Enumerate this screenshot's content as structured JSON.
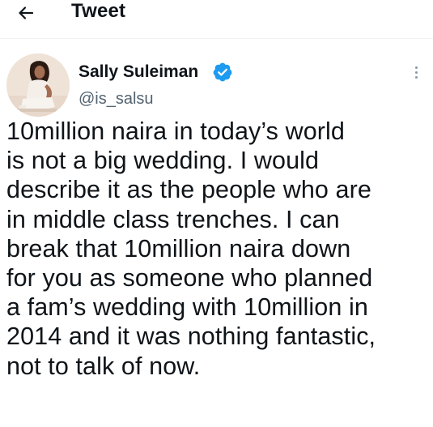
{
  "header": {
    "title": "Tweet",
    "back_icon": "arrow-left-icon"
  },
  "author": {
    "display_name": "Sally Suleiman",
    "handle": "@is_salsu",
    "verified": true,
    "verified_icon": "verified-badge-icon",
    "verified_color": "#1d9bf0",
    "avatar_icon": "profile-avatar"
  },
  "tweet": {
    "text": "10million naira in today’s world\nis not a big wedding. I would\ndescribe it as the people who are\nin middle class trenches. I can\nbreak that 10million naira down\nfor you as someone who planned\na fam’s wedding with 10million in\n2014 and it was nothing fantastic,\nnot to talk of now."
  },
  "menu": {
    "more_icon": "more-vertical-icon"
  },
  "colors": {
    "text": "#0f1419",
    "secondary_text": "#536471",
    "divider": "#eff3f4",
    "accent": "#1d9bf0"
  }
}
